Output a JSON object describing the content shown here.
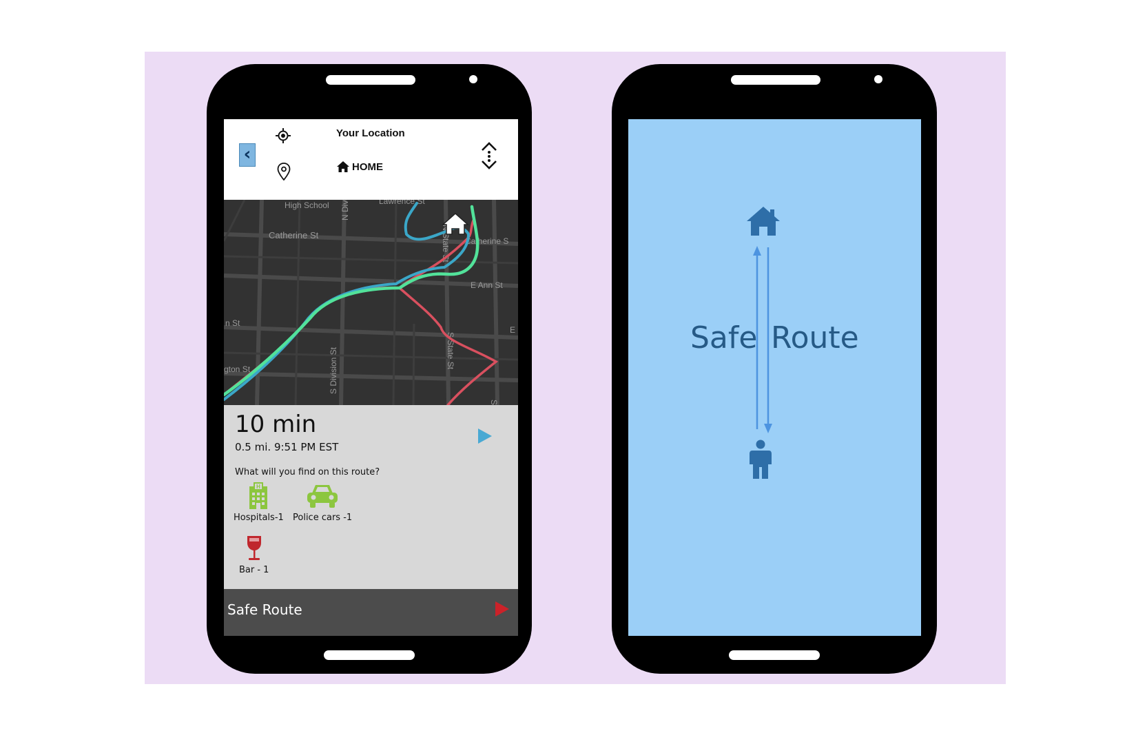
{
  "left_phone": {
    "header": {
      "from_label": "Your Location",
      "to_label": "HOME",
      "back_icon": "chevron-left-icon",
      "location_icon": "crosshair-icon",
      "destination_icon": "map-pin-icon",
      "swap_icon": "swap-vertical-icon"
    },
    "map": {
      "streets": [
        "High School",
        "Lawrence St",
        "N Div",
        "Catherine St",
        "N State St",
        "Catherine S",
        "E Ann St",
        "n St",
        "E",
        "S Division St",
        "S State St",
        "gton St",
        "S"
      ],
      "route_colors": {
        "blue": "#3ba7c8",
        "green": "#52e29a",
        "red": "#d9505f"
      },
      "marker_icon": "home-icon"
    },
    "info": {
      "eta": "10 min",
      "distance_time": "0.5 mi. 9:51 PM EST",
      "question": "What will you find on this route?",
      "features": [
        {
          "icon": "hospital-icon",
          "label": "Hospitals-1",
          "color": "#8cc63f"
        },
        {
          "icon": "car-icon",
          "label": "Police cars -1",
          "color": "#8cc63f"
        },
        {
          "icon": "wine-glass-icon",
          "label": "Bar - 1",
          "color": "#c0272d"
        }
      ],
      "play_color": "#49a9d3"
    },
    "bottom_bar": {
      "label": "Safe Route",
      "play_color": "#cc2229"
    }
  },
  "right_phone": {
    "word1": "Safe",
    "word2": "Route",
    "top_icon": "home-icon",
    "bottom_icon": "person-icon",
    "screen_color": "#9bcff7",
    "icon_color": "#2e6ea8"
  }
}
